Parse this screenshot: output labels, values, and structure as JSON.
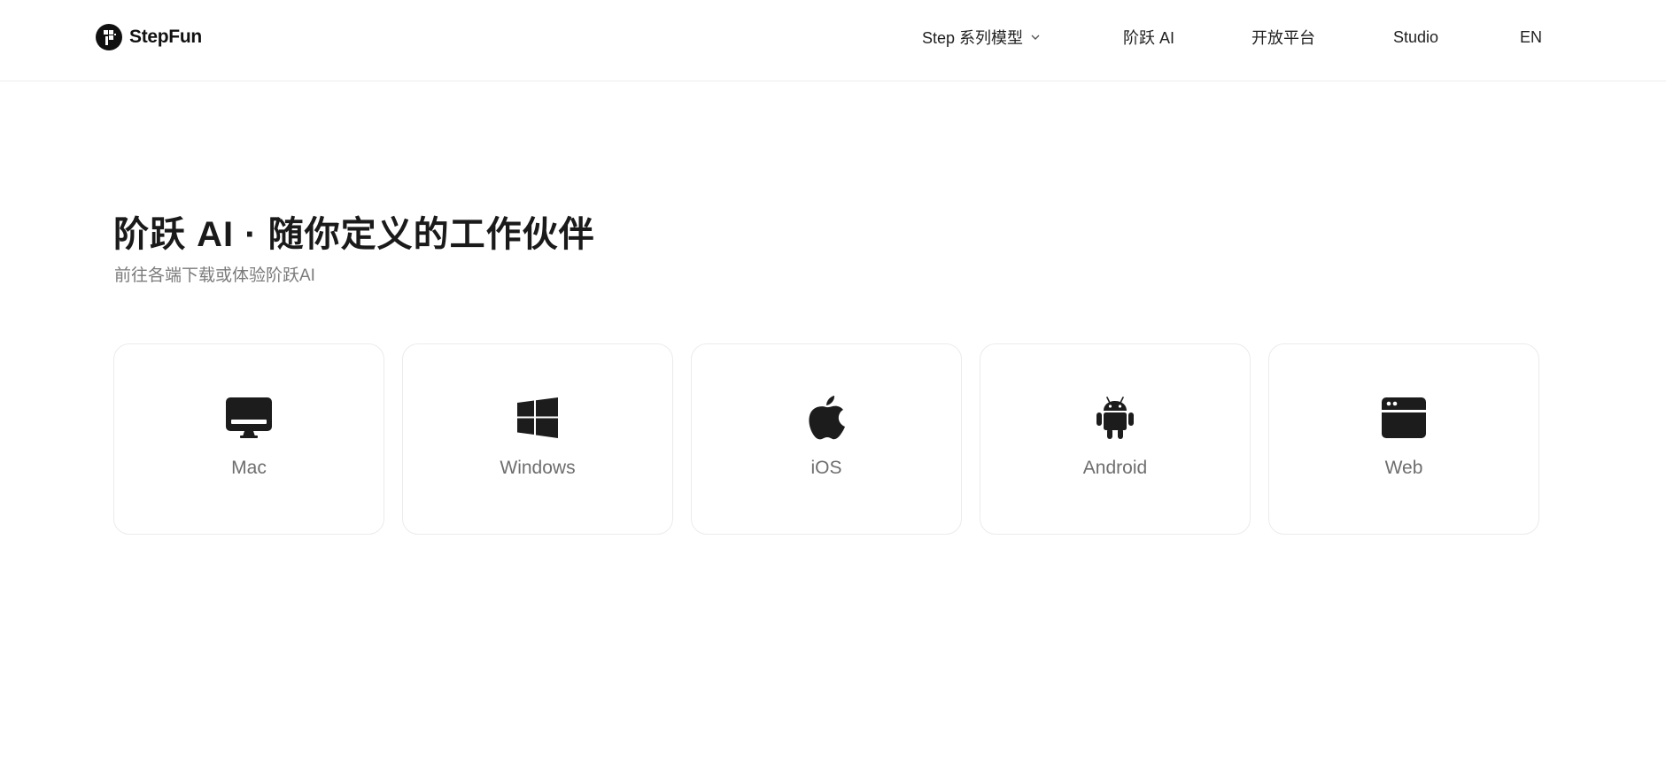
{
  "header": {
    "brand": "StepFun",
    "nav": {
      "models": "Step 系列模型",
      "ai": "阶跃 AI",
      "platform": "开放平台",
      "studio": "Studio",
      "lang": "EN"
    }
  },
  "hero": {
    "title": "阶跃 AI · 随你定义的工作伙伴",
    "subtitle": "前往各端下载或体验阶跃AI"
  },
  "platforms": [
    {
      "label": "Mac",
      "icon": "mac-monitor-icon"
    },
    {
      "label": "Windows",
      "icon": "windows-icon"
    },
    {
      "label": "iOS",
      "icon": "apple-icon"
    },
    {
      "label": "Android",
      "icon": "android-icon"
    },
    {
      "label": "Web",
      "icon": "browser-window-icon"
    }
  ],
  "colors": {
    "text": "#1a1a1a",
    "muted": "#7b7b7b",
    "card_border": "#ebebeb",
    "divider": "#ececec"
  }
}
